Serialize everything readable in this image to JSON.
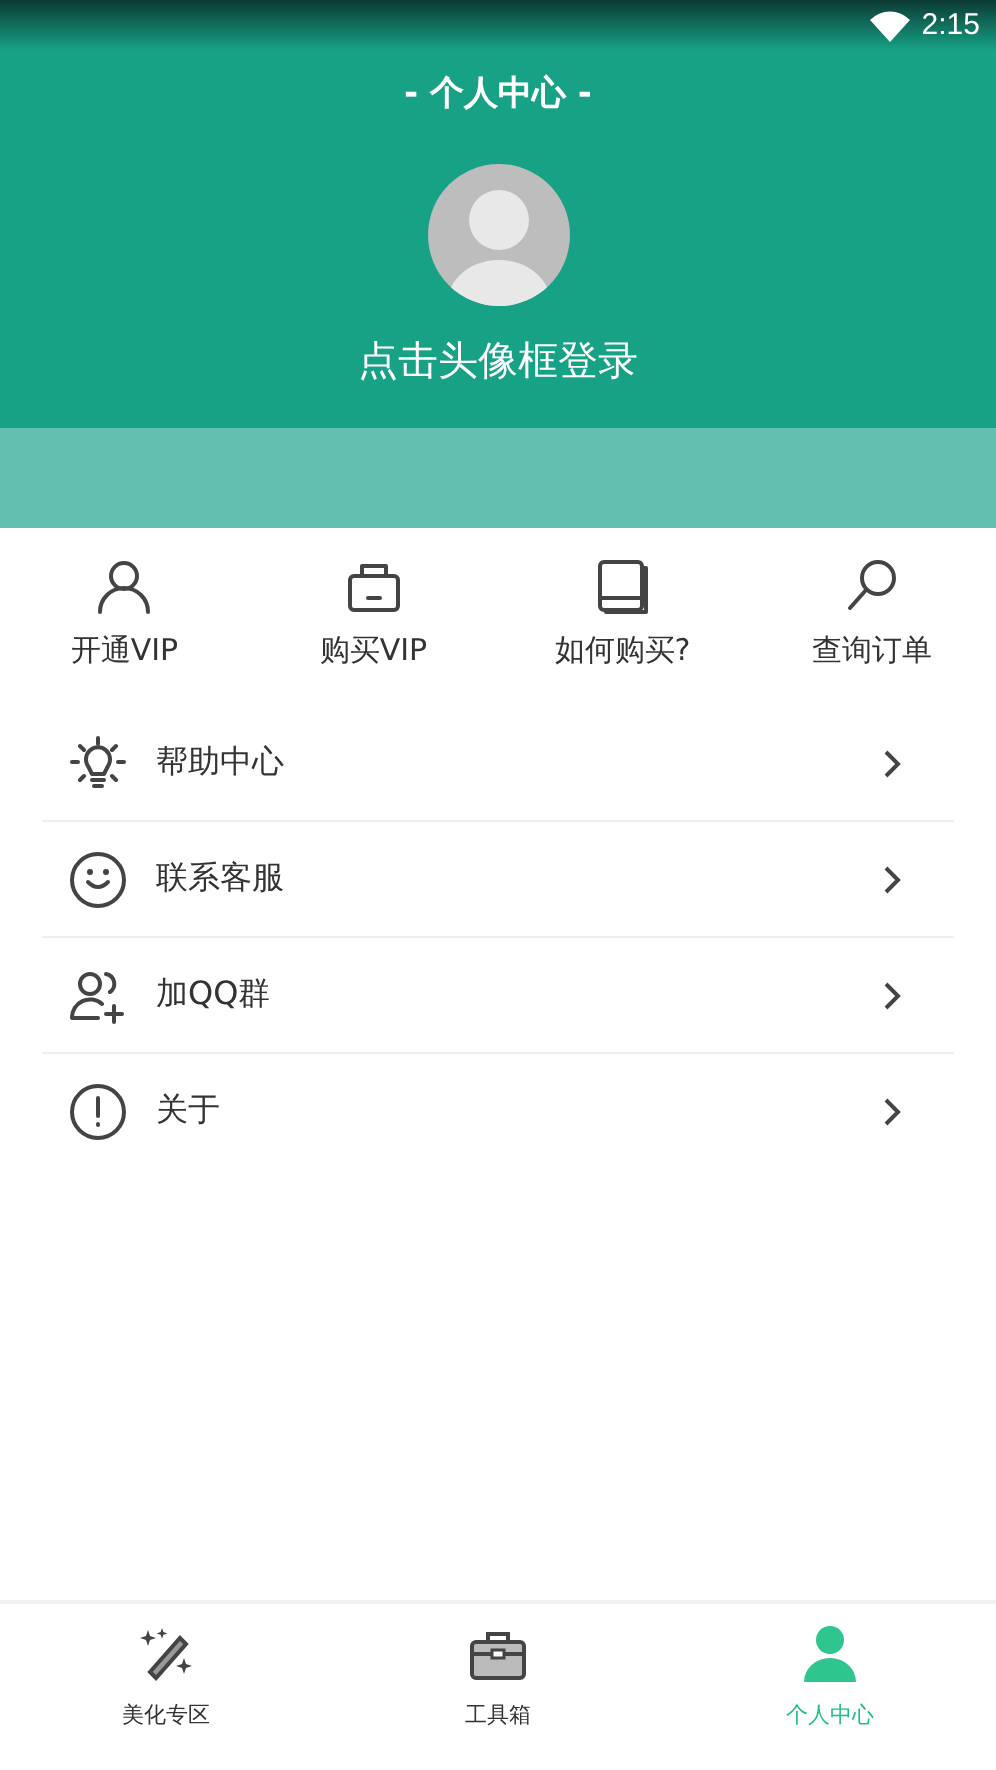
{
  "status_bar": {
    "time": "2:15"
  },
  "header": {
    "title": "- 个人中心 -",
    "login_prompt": "点击头像框登录"
  },
  "quick_actions": [
    {
      "kind": "user",
      "label": "开通VIP"
    },
    {
      "kind": "bag",
      "label": "购买VIP"
    },
    {
      "kind": "book",
      "label": "如何购买?"
    },
    {
      "kind": "search",
      "label": "查询订单"
    }
  ],
  "menu": [
    {
      "kind": "bulb",
      "label": "帮助中心"
    },
    {
      "kind": "smile",
      "label": "联系客服"
    },
    {
      "kind": "group",
      "label": "加QQ群"
    },
    {
      "kind": "info",
      "label": "关于"
    }
  ],
  "bottom_nav": [
    {
      "kind": "wand",
      "label": "美化专区",
      "selected": false
    },
    {
      "kind": "toolbox",
      "label": "工具箱",
      "selected": false
    },
    {
      "kind": "person",
      "label": "个人中心",
      "selected": true
    }
  ]
}
